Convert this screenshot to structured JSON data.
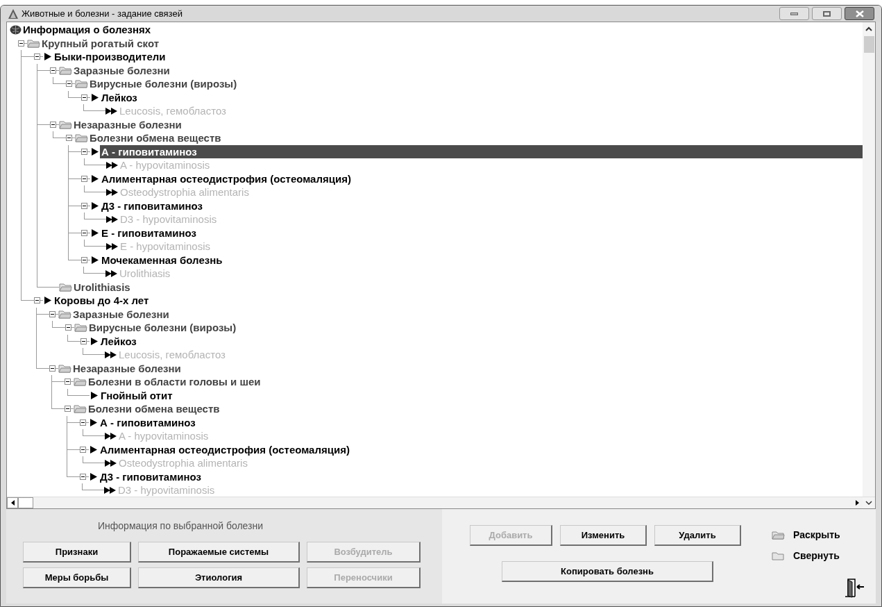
{
  "window": {
    "title": "Животные и болезни - задание связей"
  },
  "tree": {
    "kind": "root",
    "label": "Информация о болезнях",
    "selected": false,
    "children": [
      {
        "kind": "group",
        "label": "Крупный рогатый скот",
        "selected": false,
        "expanded": true,
        "children": [
          {
            "kind": "item",
            "label": "Быки-производители",
            "selected": false,
            "expanded": true,
            "children": [
              {
                "kind": "group",
                "label": "Заразные болезни",
                "selected": false,
                "expanded": true,
                "children": [
                  {
                    "kind": "group",
                    "label": "Вирусные болезни (вирозы)",
                    "selected": false,
                    "expanded": true,
                    "children": [
                      {
                        "kind": "item",
                        "label": "Лейкоз",
                        "selected": false,
                        "expanded": true,
                        "children": [
                          {
                            "kind": "latin",
                            "label": "Leucosis, гемобластоз",
                            "selected": false
                          }
                        ]
                      }
                    ]
                  }
                ]
              },
              {
                "kind": "group",
                "label": "Незаразные болезни",
                "selected": false,
                "expanded": true,
                "children": [
                  {
                    "kind": "group",
                    "label": "Болезни обмена веществ",
                    "selected": false,
                    "expanded": true,
                    "children": [
                      {
                        "kind": "item",
                        "label": "А - гиповитаминоз",
                        "selected": true,
                        "expanded": true,
                        "children": [
                          {
                            "kind": "latin",
                            "label": "A - hypovitaminosis",
                            "selected": false
                          }
                        ]
                      },
                      {
                        "kind": "item",
                        "label": "Алиментарная остеодистрофия (остеомаляция)",
                        "selected": false,
                        "expanded": true,
                        "children": [
                          {
                            "kind": "latin",
                            "label": "Osteodystrophia alimentaris",
                            "selected": false
                          }
                        ]
                      },
                      {
                        "kind": "item",
                        "label": "Д3 - гиповитаминоз",
                        "selected": false,
                        "expanded": true,
                        "children": [
                          {
                            "kind": "latin",
                            "label": "D3 - hypovitaminosis",
                            "selected": false
                          }
                        ]
                      },
                      {
                        "kind": "item",
                        "label": "Е - гиповитаминоз",
                        "selected": false,
                        "expanded": true,
                        "children": [
                          {
                            "kind": "latin",
                            "label": "E - hypovitaminosis",
                            "selected": false
                          }
                        ]
                      },
                      {
                        "kind": "item",
                        "label": "Мочекаменная болезнь",
                        "selected": false,
                        "expanded": true,
                        "children": [
                          {
                            "kind": "latin",
                            "label": "Urolithiasis",
                            "selected": false
                          }
                        ]
                      }
                    ]
                  }
                ]
              },
              {
                "kind": "group",
                "label": "Urolithiasis",
                "selected": false
              }
            ]
          },
          {
            "kind": "item",
            "label": "Коровы до 4-х лет",
            "selected": false,
            "expanded": true,
            "children": [
              {
                "kind": "group",
                "label": "Заразные болезни",
                "selected": false,
                "expanded": true,
                "children": [
                  {
                    "kind": "group",
                    "label": "Вирусные болезни (вирозы)",
                    "selected": false,
                    "expanded": true,
                    "children": [
                      {
                        "kind": "item",
                        "label": "Лейкоз",
                        "selected": false,
                        "expanded": true,
                        "children": [
                          {
                            "kind": "latin",
                            "label": "Leucosis, гемобластоз",
                            "selected": false
                          }
                        ]
                      }
                    ]
                  }
                ]
              },
              {
                "kind": "group",
                "label": "Незаразные болезни",
                "selected": false,
                "expanded": true,
                "children": [
                  {
                    "kind": "group",
                    "label": "Болезни в области головы и шеи",
                    "selected": false,
                    "expanded": true,
                    "children": [
                      {
                        "kind": "item",
                        "label": "Гнойный отит",
                        "selected": false
                      }
                    ]
                  },
                  {
                    "kind": "group",
                    "label": "Болезни обмена веществ",
                    "selected": false,
                    "expanded": true,
                    "children": [
                      {
                        "kind": "item",
                        "label": "А - гиповитаминоз",
                        "selected": false,
                        "expanded": true,
                        "children": [
                          {
                            "kind": "latin",
                            "label": "A - hypovitaminosis",
                            "selected": false
                          }
                        ]
                      },
                      {
                        "kind": "item",
                        "label": "Алиментарная остеодистрофия (остеомаляция)",
                        "selected": false,
                        "expanded": true,
                        "children": [
                          {
                            "kind": "latin",
                            "label": "Osteodystrophia alimentaris",
                            "selected": false
                          }
                        ]
                      },
                      {
                        "kind": "item",
                        "label": "Д3 - гиповитаминоз",
                        "selected": false,
                        "expanded": true,
                        "children": [
                          {
                            "kind": "latin",
                            "label": "D3 - hypovitaminosis",
                            "selected": false
                          }
                        ]
                      }
                    ]
                  }
                ]
              }
            ]
          }
        ]
      }
    ]
  },
  "info_panel": {
    "title": "Информация по выбранной болезни",
    "buttons": [
      {
        "label": "Признаки",
        "disabled": false
      },
      {
        "label": "Поражаемые системы",
        "disabled": false
      },
      {
        "label": "Возбудитель",
        "disabled": true
      },
      {
        "label": "Меры борьбы",
        "disabled": false
      },
      {
        "label": "Этиология",
        "disabled": false
      },
      {
        "label": "Переносчики",
        "disabled": true
      }
    ]
  },
  "actions": {
    "buttons": [
      {
        "label": "Добавить",
        "disabled": true
      },
      {
        "label": "Изменить",
        "disabled": false
      },
      {
        "label": "Удалить",
        "disabled": false
      }
    ],
    "copy_button": {
      "label": "Копировать болезнь",
      "disabled": false
    }
  },
  "view_controls": [
    {
      "kind": "expand",
      "label": "Раскрыть"
    },
    {
      "kind": "collapse",
      "label": "Свернуть"
    }
  ]
}
